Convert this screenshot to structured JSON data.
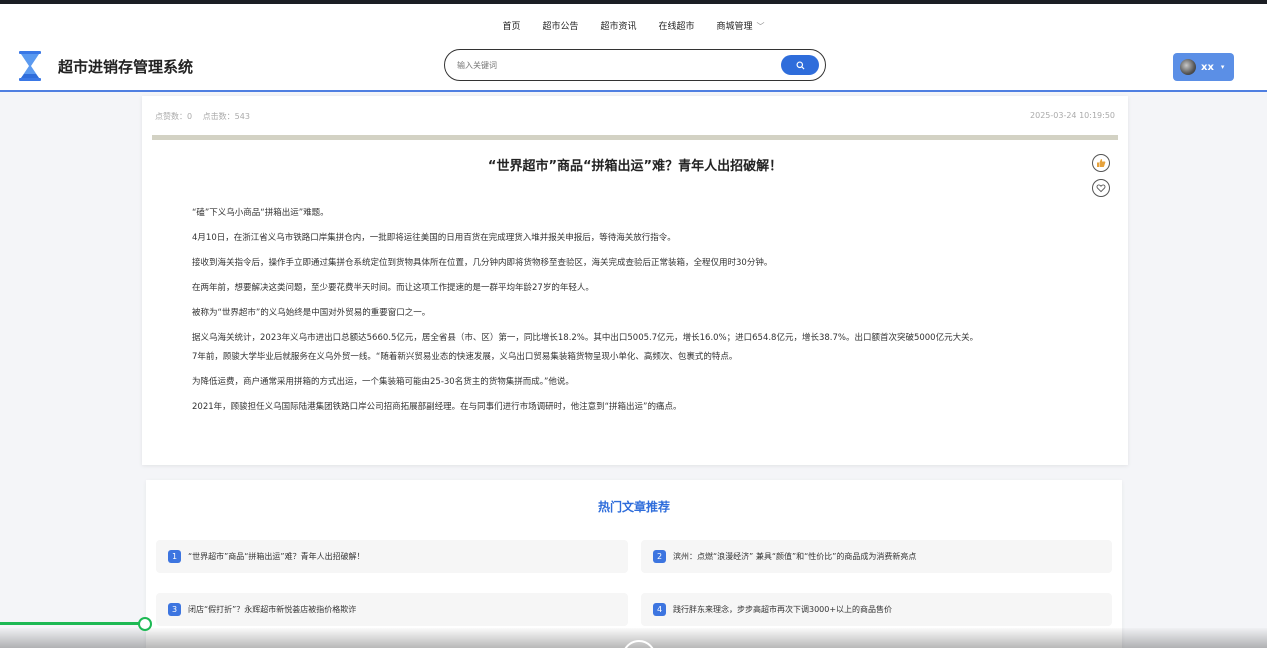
{
  "nav": {
    "items": [
      "首页",
      "超市公告",
      "超市资讯",
      "在线超市",
      "商城管理"
    ]
  },
  "brand": {
    "title": "超市进销存管理系统"
  },
  "search": {
    "placeholder": "输入关键词"
  },
  "user": {
    "name": "xx"
  },
  "article": {
    "likes_label": "点赞数：0",
    "clicks_label": "点击数：543",
    "datetime": "2025-03-24 10:19:50",
    "title": "“世界超市”商品“拼箱出运”难？青年人出招破解！",
    "paragraphs": [
      "“磕”下义乌小商品“拼箱出运”难题。",
      "4月10日，在浙江省义乌市铁路口岸集拼仓内，一批即将运往美国的日用百货在完成理货入堆并报关申报后，等待海关放行指令。",
      "接收到海关指令后，操作手立即通过集拼仓系统定位到货物具体所在位置，几分钟内即将货物移至查验区，海关完成查验后正常装箱，全程仅用时30分钟。",
      "在两年前，想要解决这类问题，至少要花费半天时间。而让这项工作提速的是一群平均年龄27岁的年轻人。",
      "被称为“世界超市”的义乌始终是中国对外贸易的重要窗口之一。",
      "据义乌海关统计，2023年义乌市进出口总额达5660.5亿元，居全省县（市、区）第一，同比增长18.2%。其中出口5005.7亿元，增长16.0%；进口654.8亿元，增长38.7%。出口额首次突破5000亿元大关。",
      "7年前，顾骏大学毕业后就服务在义乌外贸一线。“随着新兴贸易业态的快速发展，义乌出口贸易集装箱货物呈现小单化、高频次、包裹式的特点。",
      "为降低运费，商户通常采用拼箱的方式出运，一个集装箱可能由25-30名货主的货物集拼而成。”他说。",
      "2021年，顾骏担任义乌国际陆港集团铁路口岸公司招商拓展部副经理。在与同事们进行市场调研时，他注意到“拼箱出运”的痛点。"
    ]
  },
  "recommend": {
    "title": "热门文章推荐",
    "items": [
      {
        "num": "1",
        "title": "“世界超市”商品“拼箱出运”难？青年人出招破解！"
      },
      {
        "num": "2",
        "title": "滨州：点燃“浪漫经济” 兼具“颜值”和“性价比”的商品成为消费新亮点"
      },
      {
        "num": "3",
        "title": "闭店“假打折”？永辉超市新悦荟店被指价格欺诈"
      },
      {
        "num": "4",
        "title": "践行胖东来理念，步步高超市再次下调3000+以上的商品售价"
      }
    ]
  },
  "media": {
    "progress": 0.114
  },
  "colors": {
    "accent": "#2f6ddb",
    "user_button": "#5b8fe6",
    "progress": "#1db954"
  },
  "icons": [
    "hourglass-logo-icon",
    "search-icon",
    "avatar",
    "chevron-down-icon",
    "like-icon",
    "heart-icon",
    "play-icon"
  ]
}
